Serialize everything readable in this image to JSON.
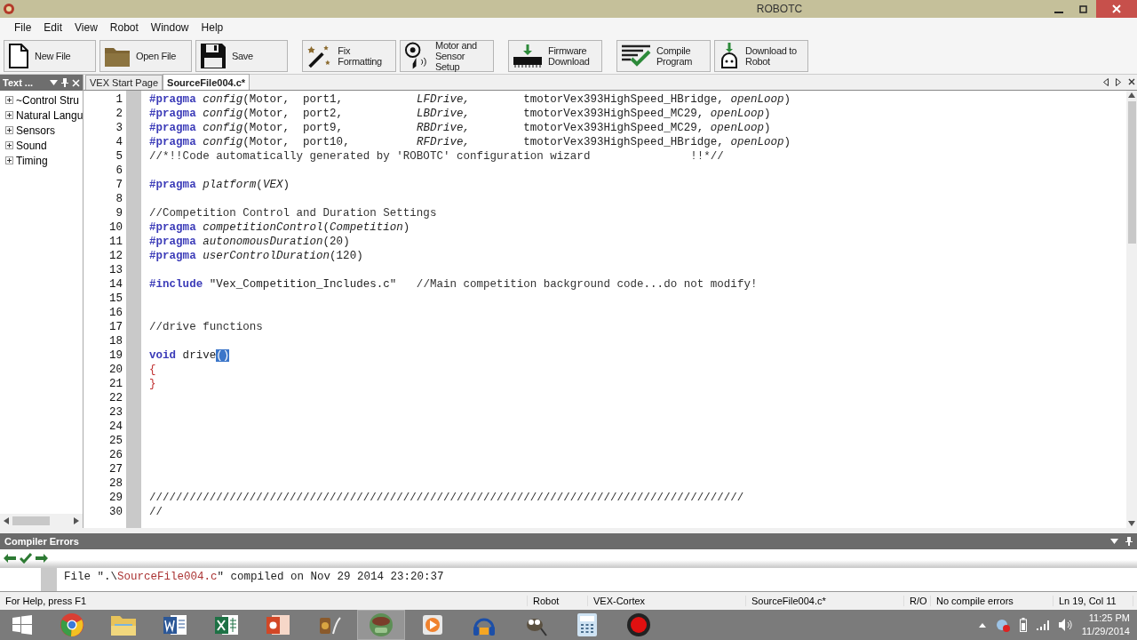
{
  "window": {
    "title": "ROBOTC"
  },
  "menu": [
    "File",
    "Edit",
    "View",
    "Robot",
    "Window",
    "Help"
  ],
  "toolbar": [
    {
      "kind": "new",
      "lines": [
        "New File"
      ]
    },
    {
      "kind": "open",
      "lines": [
        "Open File"
      ]
    },
    {
      "kind": "save",
      "lines": [
        "Save"
      ]
    },
    {
      "kind": "format",
      "lines": [
        "Fix Formatting"
      ]
    },
    {
      "kind": "motor",
      "lines": [
        "Motor and",
        "Sensor Setup"
      ]
    },
    {
      "kind": "firmware",
      "lines": [
        "Firmware",
        "Download"
      ]
    },
    {
      "kind": "compile",
      "lines": [
        "Compile",
        "Program"
      ]
    },
    {
      "kind": "download",
      "lines": [
        "Download to",
        "Robot"
      ]
    }
  ],
  "side_panel": {
    "title": "Text ...",
    "items": [
      {
        "label": "~Control Stru",
        "expanded": false
      },
      {
        "label": "Natural Langu",
        "expanded": false
      },
      {
        "label": "Sensors",
        "expanded": false
      },
      {
        "label": "Sound",
        "expanded": false
      },
      {
        "label": "Timing",
        "expanded": false
      }
    ]
  },
  "tabs": [
    {
      "label": "VEX Start Page",
      "selected": false
    },
    {
      "label": "SourceFile004.c*",
      "selected": true
    }
  ],
  "editor": {
    "lines": [
      {
        "number": "1",
        "segments": [
          {
            "kind": "directive",
            "text": "#pragma "
          },
          {
            "kind": "italic",
            "text": "config"
          },
          {
            "kind": "plain",
            "text": "(Motor,  port1,           "
          },
          {
            "kind": "italic",
            "text": "LFDrive,"
          },
          {
            "kind": "plain",
            "text": "        tmotorVex393HighSpeed_HBridge, "
          },
          {
            "kind": "italic",
            "text": "openLoop"
          },
          {
            "kind": "plain",
            "text": ")"
          }
        ]
      },
      {
        "number": "2",
        "segments": [
          {
            "kind": "directive",
            "text": "#pragma "
          },
          {
            "kind": "italic",
            "text": "config"
          },
          {
            "kind": "plain",
            "text": "(Motor,  port2,           "
          },
          {
            "kind": "italic",
            "text": "LBDrive,"
          },
          {
            "kind": "plain",
            "text": "        tmotorVex393HighSpeed_MC29, "
          },
          {
            "kind": "italic",
            "text": "openLoop"
          },
          {
            "kind": "plain",
            "text": ")"
          }
        ]
      },
      {
        "number": "3",
        "segments": [
          {
            "kind": "directive",
            "text": "#pragma "
          },
          {
            "kind": "italic",
            "text": "config"
          },
          {
            "kind": "plain",
            "text": "(Motor,  port9,           "
          },
          {
            "kind": "italic",
            "text": "RBDrive,"
          },
          {
            "kind": "plain",
            "text": "        tmotorVex393HighSpeed_MC29, "
          },
          {
            "kind": "italic",
            "text": "openLoop"
          },
          {
            "kind": "plain",
            "text": ")"
          }
        ]
      },
      {
        "number": "4",
        "segments": [
          {
            "kind": "directive",
            "text": "#pragma "
          },
          {
            "kind": "italic",
            "text": "config"
          },
          {
            "kind": "plain",
            "text": "(Motor,  port10,          "
          },
          {
            "kind": "italic",
            "text": "RFDrive,"
          },
          {
            "kind": "plain",
            "text": "        tmotorVex393HighSpeed_HBridge, "
          },
          {
            "kind": "italic",
            "text": "openLoop"
          },
          {
            "kind": "plain",
            "text": ")"
          }
        ]
      },
      {
        "number": "5",
        "segments": [
          {
            "kind": "comment",
            "text": "//*!!Code automatically generated by 'ROBOTC' configuration wizard               !!*//"
          }
        ]
      },
      {
        "number": "6"
      },
      {
        "number": "7",
        "segments": [
          {
            "kind": "directive",
            "text": "#pragma "
          },
          {
            "kind": "italic",
            "text": "platform"
          },
          {
            "kind": "plain",
            "text": "("
          },
          {
            "kind": "italic",
            "text": "VEX"
          },
          {
            "kind": "plain",
            "text": ")"
          }
        ]
      },
      {
        "number": "8"
      },
      {
        "number": "9",
        "segments": [
          {
            "kind": "comment",
            "text": "//Competition Control and Duration Settings"
          }
        ]
      },
      {
        "number": "10",
        "segments": [
          {
            "kind": "directive",
            "text": "#pragma "
          },
          {
            "kind": "italic",
            "text": "competitionControl"
          },
          {
            "kind": "plain",
            "text": "("
          },
          {
            "kind": "italic",
            "text": "Competition"
          },
          {
            "kind": "plain",
            "text": ")"
          }
        ]
      },
      {
        "number": "11",
        "segments": [
          {
            "kind": "directive",
            "text": "#pragma "
          },
          {
            "kind": "italic",
            "text": "autonomousDuration"
          },
          {
            "kind": "plain",
            "text": "(20)"
          }
        ]
      },
      {
        "number": "12",
        "segments": [
          {
            "kind": "directive",
            "text": "#pragma "
          },
          {
            "kind": "italic",
            "text": "userControlDuration"
          },
          {
            "kind": "plain",
            "text": "(120)"
          }
        ]
      },
      {
        "number": "13"
      },
      {
        "number": "14",
        "segments": [
          {
            "kind": "directive",
            "text": "#include"
          },
          {
            "kind": "plain",
            "text": " \"Vex_Competition_Includes.c\"   "
          },
          {
            "kind": "comment",
            "text": "//Main competition background code...do not modify!"
          }
        ]
      },
      {
        "number": "15"
      },
      {
        "number": "16"
      },
      {
        "number": "17",
        "segments": [
          {
            "kind": "comment",
            "text": "//drive functions"
          }
        ]
      },
      {
        "number": "18"
      },
      {
        "number": "19",
        "segments": [
          {
            "kind": "directive",
            "text": "void"
          },
          {
            "kind": "plain",
            "text": " drive"
          },
          {
            "kind": "selected",
            "text": "()"
          }
        ]
      },
      {
        "number": "20",
        "segments": [
          {
            "kind": "brace",
            "text": "{"
          }
        ]
      },
      {
        "number": "21",
        "segments": [
          {
            "kind": "brace",
            "text": "}"
          }
        ]
      },
      {
        "number": "22"
      },
      {
        "number": "23"
      },
      {
        "number": "24"
      },
      {
        "number": "25"
      },
      {
        "number": "26"
      },
      {
        "number": "27"
      },
      {
        "number": "28"
      },
      {
        "number": "29",
        "segments": [
          {
            "kind": "comment",
            "text": "/////////////////////////////////////////////////////////////////////////////////////////"
          }
        ]
      },
      {
        "number": "30",
        "segments": [
          {
            "kind": "comment",
            "text": "//"
          }
        ]
      }
    ]
  },
  "compiler_errors": {
    "title": "Compiler Errors",
    "output": [
      {
        "kind": "plain",
        "text": "File \".\\"
      },
      {
        "kind": "path",
        "text": "SourceFile004.c"
      },
      {
        "kind": "plain",
        "text": "\" compiled on Nov 29 2014 23:20:37"
      }
    ]
  },
  "status_bar": {
    "help": "For Help, press F1",
    "robot": "Robot",
    "platform": "VEX-Cortex",
    "file": "SourceFile004.c*",
    "mode": "R/O",
    "errors": "No compile errors",
    "position": "Ln 19, Col 11"
  },
  "taskbar": {
    "apps": [
      {
        "kind": "browser",
        "selected": false
      },
      {
        "kind": "folder",
        "selected": false
      },
      {
        "kind": "word",
        "selected": false
      },
      {
        "kind": "sheet",
        "selected": false
      },
      {
        "kind": "slides",
        "selected": false
      },
      {
        "kind": "media",
        "selected": false
      },
      {
        "kind": "robotc",
        "selected": true
      },
      {
        "kind": "player",
        "selected": false
      },
      {
        "kind": "headphones",
        "selected": false
      },
      {
        "kind": "paint",
        "selected": false
      },
      {
        "kind": "calculator",
        "selected": false
      },
      {
        "kind": "record",
        "selected": false
      }
    ],
    "time": "11:25 PM",
    "date": "11/29/2014"
  }
}
